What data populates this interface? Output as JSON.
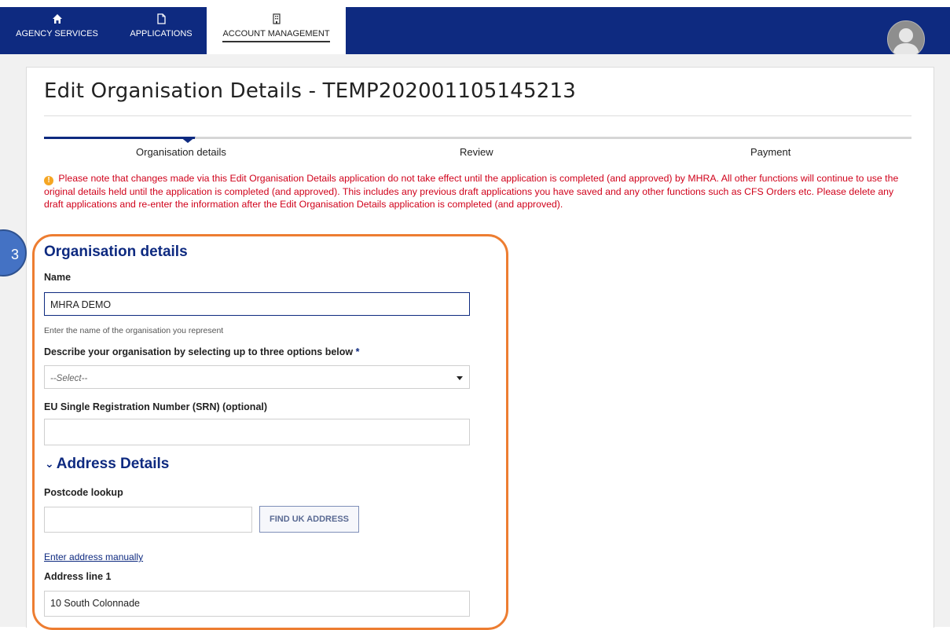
{
  "nav": {
    "items": [
      {
        "label": "AGENCY SERVICES",
        "icon": "home-icon"
      },
      {
        "label": "APPLICATIONS",
        "icon": "document-icon"
      },
      {
        "label": "ACCOUNT MANAGEMENT",
        "icon": "building-icon",
        "active": true
      }
    ],
    "avatar_icon": "user-avatar-icon"
  },
  "page": {
    "title": "Edit Organisation Details - TEMP202001105145213"
  },
  "steps": [
    {
      "label": "Organisation details",
      "active": true
    },
    {
      "label": "Review"
    },
    {
      "label": "Payment"
    }
  ],
  "warning": {
    "icon": "exclamation-icon",
    "text": "Please note that changes made via this Edit Organisation Details application do not take effect until the application is completed (and approved) by MHRA. All other functions will continue to use the original details held until the application is completed (and approved). This includes any previous draft applications you have saved and any other functions such as CFS Orders etc. Please delete any draft applications and re-enter the information after the Edit Organisation Details application is completed (and approved)."
  },
  "badge": {
    "number": "3"
  },
  "form": {
    "section_title": "Organisation details",
    "name_label": "Name",
    "name_value": "MHRA DEMO",
    "name_hint": "Enter the name of the organisation you represent",
    "describe_label": "Describe your organisation by selecting up to three options below",
    "describe_required": "*",
    "describe_placeholder": "--Select--",
    "srn_label": "EU Single Registration Number (SRN) (optional)",
    "srn_value": "",
    "address_section_title": "Address Details",
    "postcode_label": "Postcode lookup",
    "postcode_value": "",
    "find_button": "FIND UK ADDRESS",
    "manual_link": "Enter address manually",
    "address1_label": "Address line 1",
    "address1_value": "10 South Colonnade"
  },
  "colors": {
    "nav_bg": "#0e2a80",
    "warning_text": "#d0021b",
    "highlight": "#ed7d31",
    "badge": "#4472c4"
  }
}
